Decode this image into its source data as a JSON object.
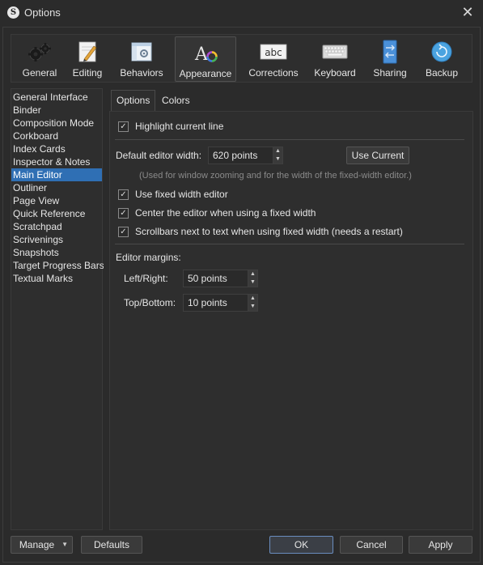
{
  "window": {
    "title": "Options",
    "app_icon_letter": "S"
  },
  "toolbar": {
    "items": [
      {
        "label": "General",
        "icon": "gears-icon"
      },
      {
        "label": "Editing",
        "icon": "pen-icon"
      },
      {
        "label": "Behaviors",
        "icon": "settings-window-icon"
      },
      {
        "label": "Appearance",
        "icon": "font-color-icon"
      },
      {
        "label": "Corrections",
        "icon": "abc-icon"
      },
      {
        "label": "Keyboard",
        "icon": "keyboard-icon"
      },
      {
        "label": "Sharing",
        "icon": "sharing-icon"
      },
      {
        "label": "Backup",
        "icon": "backup-icon"
      }
    ],
    "active": "Appearance"
  },
  "sidebar": {
    "items": [
      "General Interface",
      "Binder",
      "Composition Mode",
      "Corkboard",
      "Index Cards",
      "Inspector & Notes",
      "Main Editor",
      "Outliner",
      "Page View",
      "Quick Reference",
      "Scratchpad",
      "Scrivenings",
      "Snapshots",
      "Target Progress Bars",
      "Textual Marks"
    ],
    "selected": "Main Editor"
  },
  "tabs": {
    "options": "Options",
    "colors": "Colors"
  },
  "main_editor": {
    "highlight_current_line": {
      "label": "Highlight current line",
      "checked": true
    },
    "default_width_label": "Default editor width:",
    "default_width_value": "620 points",
    "use_current_label": "Use Current",
    "width_hint": "(Used for window zooming and for the width of the fixed-width editor.)",
    "use_fixed_width": {
      "label": "Use fixed width editor",
      "checked": true
    },
    "center_editor": {
      "label": "Center the editor when using a fixed width",
      "checked": true
    },
    "scrollbars_next": {
      "label": "Scrollbars next to text when using fixed width (needs a restart)",
      "checked": true
    },
    "margins_heading": "Editor margins:",
    "left_right_label": "Left/Right:",
    "left_right_value": "50 points",
    "top_bottom_label": "Top/Bottom:",
    "top_bottom_value": "10 points"
  },
  "footer": {
    "manage": "Manage",
    "defaults": "Defaults",
    "ok": "OK",
    "cancel": "Cancel",
    "apply": "Apply"
  },
  "colors": {
    "selection": "#2f6fb4",
    "background": "#2b2b2b",
    "accent_default_button": "#6a8dbf"
  }
}
